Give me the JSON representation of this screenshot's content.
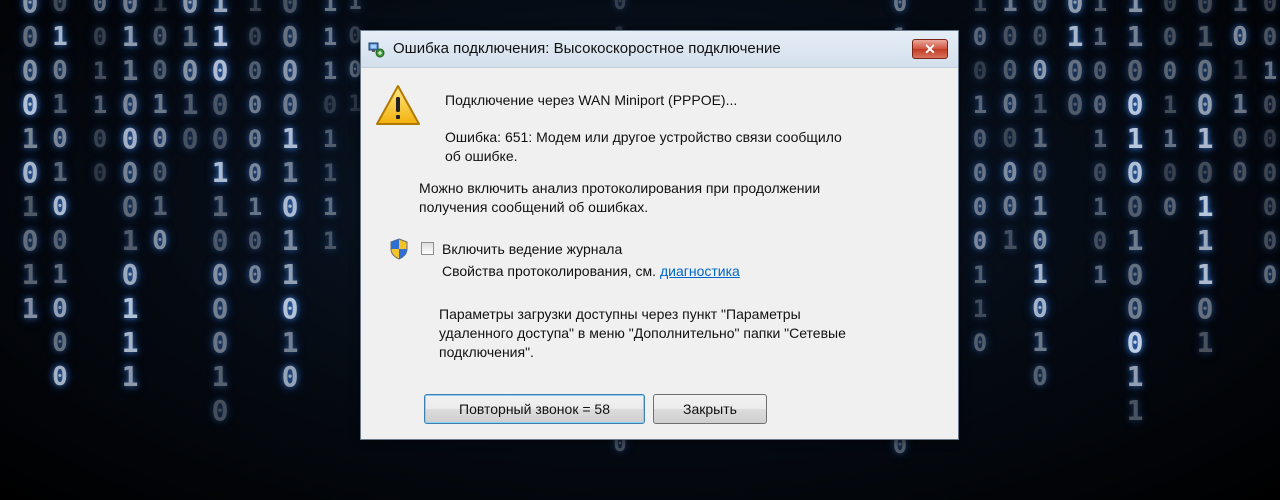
{
  "dialog": {
    "title": "Ошибка подключения: Высокоскоростное подключение",
    "close_label": "✕",
    "connecting_line": "Подключение через WAN Miniport (PPPOE)...",
    "error_line1": "Ошибка: 651: Модем или другое устройство связи сообщило",
    "error_line2": "об ошибке.",
    "logging_line1": "Можно включить анализ протоколирования при продолжении",
    "logging_line2": "получения сообщений об ошибках.",
    "checkbox_label": "Включить ведение журнала",
    "props_text": "Свойства протоколирования, см. ",
    "props_link": "диагностика",
    "params_line1": "Параметры загрузки доступны через пункт \"Параметры",
    "params_line2": "удаленного доступа\" в меню \"Дополнительно\" папки \"Сетевые",
    "params_line3": "подключения\".",
    "redial_button": "Повторный звонок = 58",
    "close_button": "Закрыть"
  },
  "background_icon": "binary-matrix-rain"
}
